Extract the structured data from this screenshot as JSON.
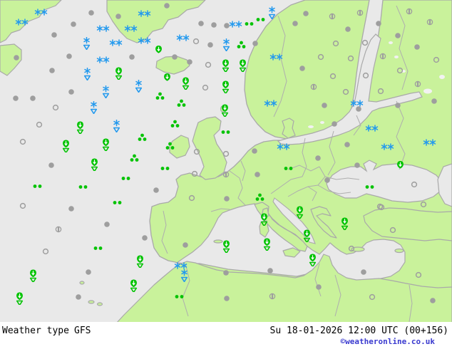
{
  "footer": {
    "label": "Weather type",
    "model": "GFS",
    "timestamp": "Su 18-01-2026 12:00 UTC (00+156)",
    "copyright": "©weatheronline.co.uk",
    "copyright_color": "#3a3acf"
  },
  "map": {
    "colors": {
      "sea": "#e9e9e9",
      "land": "#c9f29b",
      "coast": "#a9a9a9",
      "lake": "#f2f2f2",
      "green": "#00c300",
      "blue": "#2299ee",
      "gray": "#9e9e9e"
    },
    "symbol_types": {
      "clear": "clear sky (open circle)",
      "partly": "partly cloudy (circle with bar)",
      "cloudy": "cloudy (filled circle)",
      "drizzle": "drizzle (two green dots)",
      "rain3": "rain (three green dots)",
      "rain": "rain (green drop with arrow)",
      "rain-shower": "rain shower (green drop over open triangle)",
      "snow": "snow (two blue snowflakes)",
      "snow-shower": "snow shower (blue snowflake over open triangle)"
    },
    "symbols": [
      [
        "snow",
        57,
        17
      ],
      [
        "snow",
        30,
        31
      ],
      [
        "snow",
        202,
        19
      ],
      [
        "snow",
        144,
        40
      ],
      [
        "snow",
        183,
        40
      ],
      [
        "snow",
        162,
        60
      ],
      [
        "snow",
        202,
        57
      ],
      [
        "snow",
        144,
        84
      ],
      [
        "snow",
        330,
        34
      ],
      [
        "snow",
        256,
        53
      ],
      [
        "snow",
        387,
        80
      ],
      [
        "snow",
        379,
        145
      ],
      [
        "snow",
        397,
        206
      ],
      [
        "snow",
        500,
        145
      ],
      [
        "snow",
        521,
        180
      ],
      [
        "snow",
        543,
        206
      ],
      [
        "snow",
        602,
        200
      ],
      [
        "snow",
        253,
        373
      ],
      [
        "snow-shower",
        121,
        61
      ],
      [
        "snow-shower",
        122,
        104
      ],
      [
        "snow-shower",
        194,
        121
      ],
      [
        "snow-shower",
        148,
        129
      ],
      [
        "snow-shower",
        131,
        151
      ],
      [
        "snow-shower",
        381,
        18
      ],
      [
        "snow-shower",
        317,
        63
      ],
      [
        "snow-shower",
        163,
        177
      ],
      [
        "snow-shower",
        258,
        387
      ],
      [
        "rain",
        222,
        69
      ],
      [
        "rain",
        234,
        108
      ],
      [
        "rain",
        561,
        231
      ],
      [
        "rain-shower",
        166,
        103
      ],
      [
        "rain-shower",
        260,
        117
      ],
      [
        "rain-shower",
        316,
        92
      ],
      [
        "rain-shower",
        340,
        92
      ],
      [
        "rain-shower",
        316,
        122
      ],
      [
        "rain-shower",
        315,
        155
      ],
      [
        "rain-shower",
        112,
        179
      ],
      [
        "rain-shower",
        92,
        205
      ],
      [
        "rain-shower",
        148,
        203
      ],
      [
        "rain-shower",
        132,
        231
      ],
      [
        "rain-shower",
        370,
        308
      ],
      [
        "rain-shower",
        420,
        298
      ],
      [
        "rain-shower",
        430,
        331
      ],
      [
        "rain-shower",
        374,
        343
      ],
      [
        "rain-shower",
        483,
        314
      ],
      [
        "rain-shower",
        317,
        346
      ],
      [
        "rain-shower",
        438,
        365
      ],
      [
        "rain-shower",
        196,
        367
      ],
      [
        "rain-shower",
        46,
        387
      ],
      [
        "rain-shower",
        187,
        401
      ],
      [
        "rain-shower",
        27,
        419
      ],
      [
        "rain3",
        338,
        63
      ],
      [
        "rain3",
        224,
        135
      ],
      [
        "rain3",
        254,
        145
      ],
      [
        "rain3",
        199,
        193
      ],
      [
        "rain3",
        188,
        222
      ],
      [
        "rain3",
        245,
        174
      ],
      [
        "rain3",
        238,
        205
      ],
      [
        "rain3",
        364,
        277
      ],
      [
        "drizzle",
        349,
        33
      ],
      [
        "drizzle",
        365,
        27
      ],
      [
        "drizzle",
        52,
        261
      ],
      [
        "drizzle",
        116,
        262
      ],
      [
        "drizzle",
        164,
        284
      ],
      [
        "drizzle",
        176,
        250
      ],
      [
        "drizzle",
        316,
        185
      ],
      [
        "drizzle",
        231,
        236
      ],
      [
        "drizzle",
        404,
        236
      ],
      [
        "drizzle",
        518,
        262
      ],
      [
        "drizzle",
        137,
        348
      ],
      [
        "drizzle",
        251,
        416
      ],
      [
        "cloudy",
        128,
        18
      ],
      [
        "cloudy",
        103,
        34
      ],
      [
        "cloudy",
        166,
        23
      ],
      [
        "cloudy",
        76,
        49
      ],
      [
        "cloudy",
        97,
        79
      ],
      [
        "cloudy",
        185,
        80
      ],
      [
        "cloudy",
        23,
        81
      ],
      [
        "cloudy",
        73,
        99
      ],
      [
        "cloudy",
        22,
        138
      ],
      [
        "cloudy",
        46,
        138
      ],
      [
        "cloudy",
        100,
        129
      ],
      [
        "cloudy",
        234,
        8
      ],
      [
        "cloudy",
        282,
        33
      ],
      [
        "cloudy",
        300,
        35
      ],
      [
        "cloudy",
        318,
        36
      ],
      [
        "cloudy",
        414,
        33
      ],
      [
        "cloudy",
        295,
        63
      ],
      [
        "cloudy",
        358,
        61
      ],
      [
        "cloudy",
        245,
        80
      ],
      [
        "cloudy",
        266,
        87
      ],
      [
        "cloudy",
        429,
        19
      ],
      [
        "cloudy",
        488,
        41
      ],
      [
        "cloudy",
        531,
        33
      ],
      [
        "cloudy",
        558,
        50
      ],
      [
        "cloudy",
        585,
        66
      ],
      [
        "cloudy",
        424,
        96
      ],
      [
        "cloudy",
        455,
        148
      ],
      [
        "cloudy",
        503,
        153
      ],
      [
        "cloudy",
        558,
        148
      ],
      [
        "cloudy",
        609,
        142
      ],
      [
        "cloudy",
        72,
        232
      ],
      [
        "cloudy",
        100,
        293
      ],
      [
        "cloudy",
        150,
        315
      ],
      [
        "cloudy",
        357,
        212
      ],
      [
        "cloudy",
        361,
        245
      ],
      [
        "cloudy",
        318,
        279
      ],
      [
        "cloudy",
        219,
        267
      ],
      [
        "cloudy",
        469,
        174
      ],
      [
        "cloudy",
        487,
        203
      ],
      [
        "cloudy",
        446,
        222
      ],
      [
        "cloudy",
        459,
        253
      ],
      [
        "cloudy",
        501,
        232
      ],
      [
        "cloudy",
        203,
        334
      ],
      [
        "cloudy",
        124,
        382
      ],
      [
        "cloudy",
        110,
        417
      ],
      [
        "cloudy",
        260,
        344
      ],
      [
        "cloudy",
        317,
        383
      ],
      [
        "cloudy",
        318,
        419
      ],
      [
        "cloudy",
        379,
        380
      ],
      [
        "cloudy",
        510,
        382
      ],
      [
        "cloudy",
        447,
        403
      ],
      [
        "cloudy",
        607,
        422
      ],
      [
        "partly",
        466,
        23
      ],
      [
        "partly",
        505,
        18
      ],
      [
        "partly",
        574,
        16
      ],
      [
        "partly",
        603,
        31
      ],
      [
        "partly",
        537,
        79
      ],
      [
        "partly",
        586,
        118
      ],
      [
        "partly",
        440,
        122
      ],
      [
        "partly",
        317,
        245
      ],
      [
        "partly",
        82,
        322
      ],
      [
        "partly",
        382,
        416
      ],
      [
        "clear",
        78,
        151
      ],
      [
        "clear",
        275,
        58
      ],
      [
        "clear",
        292,
        91
      ],
      [
        "clear",
        288,
        123
      ],
      [
        "clear",
        471,
        61
      ],
      [
        "clear",
        512,
        60
      ],
      [
        "clear",
        450,
        80
      ],
      [
        "clear",
        492,
        82
      ],
      [
        "clear",
        612,
        84
      ],
      [
        "clear",
        467,
        107
      ],
      [
        "clear",
        513,
        106
      ],
      [
        "clear",
        561,
        99
      ],
      [
        "clear",
        485,
        129
      ],
      [
        "clear",
        534,
        128
      ],
      [
        "clear",
        55,
        175
      ],
      [
        "clear",
        32,
        199
      ],
      [
        "clear",
        32,
        289
      ],
      [
        "clear",
        276,
        213
      ],
      [
        "clear",
        317,
        216
      ],
      [
        "clear",
        273,
        244
      ],
      [
        "clear",
        269,
        278
      ],
      [
        "clear",
        581,
        259
      ],
      [
        "clear",
        535,
        291
      ],
      [
        "clear",
        594,
        287
      ],
      [
        "clear",
        64,
        353
      ],
      [
        "clear",
        587,
        386
      ],
      [
        "clear",
        522,
        417
      ],
      [
        "clear",
        493,
        349
      ],
      [
        "clear",
        533,
        290
      ],
      [
        "clear",
        551,
        323
      ]
    ]
  }
}
